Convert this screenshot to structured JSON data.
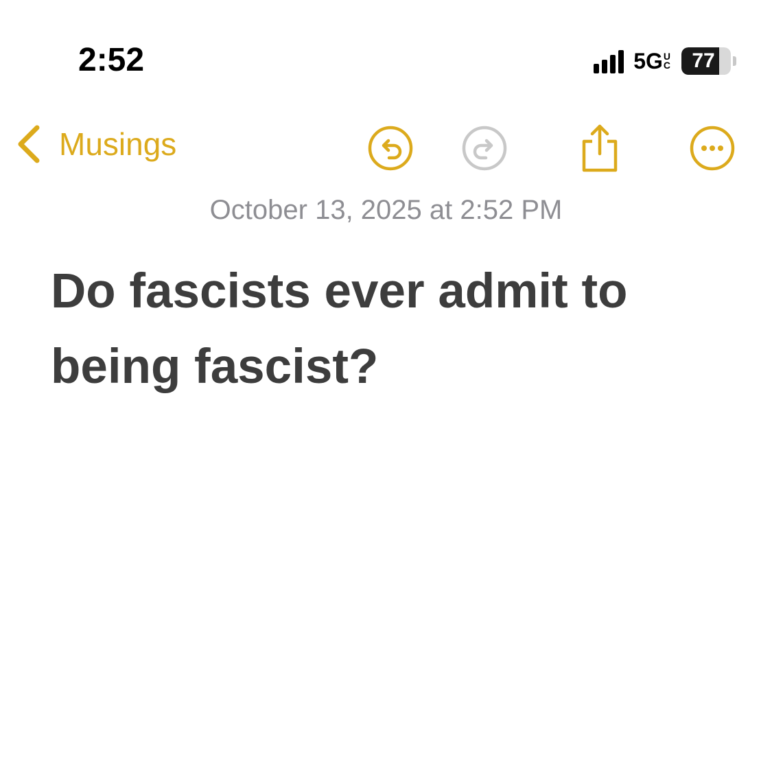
{
  "status_bar": {
    "time": "2:52",
    "network": "5G",
    "network_suffix_top": "U",
    "network_suffix_bottom": "C",
    "battery_level": "77",
    "battery_fraction": 0.77,
    "signal_bars": 4
  },
  "nav": {
    "back_label": "Musings",
    "undo_icon": "undo-icon",
    "redo_icon": "redo-icon",
    "share_icon": "share-icon",
    "more_icon": "more-icon",
    "accent_color": "#dcaa1c",
    "disabled_color": "#c8c8c8"
  },
  "note": {
    "date": "October 13, 2025 at 2:52 PM",
    "title": "Do fascists ever admit to being fascist?"
  }
}
